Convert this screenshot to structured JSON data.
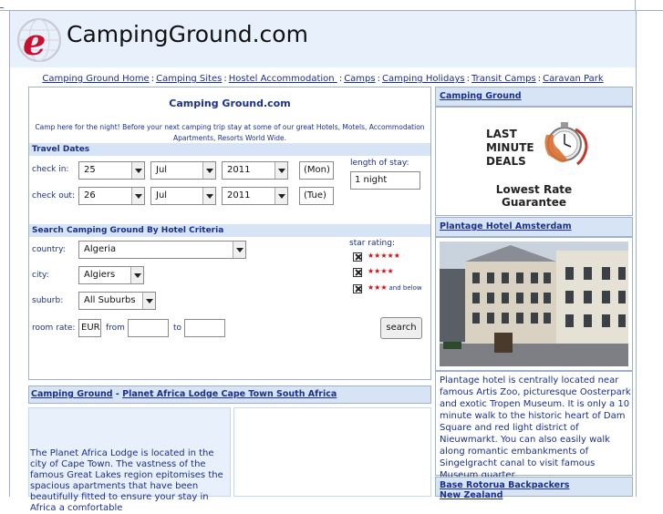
{
  "site": {
    "logo_text": "CampingGround.com"
  },
  "nav": {
    "items": [
      "Camping Ground Home",
      "Camping Sites",
      "Hostel Accommodation ",
      "Camps",
      "Camping Holidays",
      "Transit Camps",
      "Caravan Park"
    ],
    "separator": ":"
  },
  "main": {
    "title": "Camping Ground.com",
    "intro_line1": "Camp here for the night!  Before your next camping trip stay at some of our great Hotels, Motels, Accommodation",
    "intro_line2": "Apartments, Resorts World Wide."
  },
  "travel": {
    "heading": "Travel Dates",
    "checkin_label": "check in:",
    "checkout_label": "check out:",
    "checkin_day": "25",
    "checkin_month": "Jul",
    "checkin_year": "2011",
    "checkin_weekday": "(Mon)",
    "checkout_day": "26",
    "checkout_month": "Jul",
    "checkout_year": "2011",
    "checkout_weekday": "(Tue)",
    "length_label": "length of stay:",
    "length_value": "1 night"
  },
  "search": {
    "heading": "Search  Camping Ground By Hotel Criteria",
    "country_label": "country:",
    "country_value": "Algeria",
    "city_label": "city:",
    "city_value": "Algiers",
    "suburb_label": "suburb:",
    "suburb_value": "All Suburbs",
    "room_rate_label": "room rate:",
    "currency_value": "EUR",
    "from_label": "from",
    "to_label": "to",
    "star_rating_label": "star rating:",
    "stars_5": "★★★★★",
    "stars_4": "★★★★",
    "stars_3": "★★★",
    "and_below": "and below",
    "search_button": "search"
  },
  "sidebar": {
    "camping_ground_link": "Camping Ground",
    "deal_line1": "LAST",
    "deal_line2": "MINUTE",
    "deal_line3": "DEALS",
    "lowest_line1": "Lowest Rate",
    "lowest_line2": "Guarantee",
    "hotel_link": "Plantage Hotel Amsterdam",
    "hotel_text": "Plantage hotel is centrally located near famous Artis Zoo, picturesque Oosterpark and exotic Tropen Museum.  It is only a 10 minute walk to the historic heart of Dam Square and red light district of Nieuwmarkt. You can also easily walk along romantic embankments of Singelgracht canal to visit famous Museum quarter.",
    "next_link_line1": "Base Rotorua Backpackers",
    "next_link_line2": "New Zealand"
  },
  "bottom": {
    "link1": "Camping Ground",
    "dash": " - ",
    "link2": "Planet Africa Lodge Cape Town South Africa",
    "text": "The Planet Africa Lodge is located in the city of Cape Town. The vastness of the famous Great Lakes region epitomises the spacious apartments that have been beautifully fitted to ensure your stay in Africa a comfortable"
  },
  "colors": {
    "link": "#1a2f8f",
    "header_bg": "#e8f0fb",
    "section_bg": "#d6e4f5",
    "border": "#9fb0c8",
    "stars": "#cc1111"
  }
}
